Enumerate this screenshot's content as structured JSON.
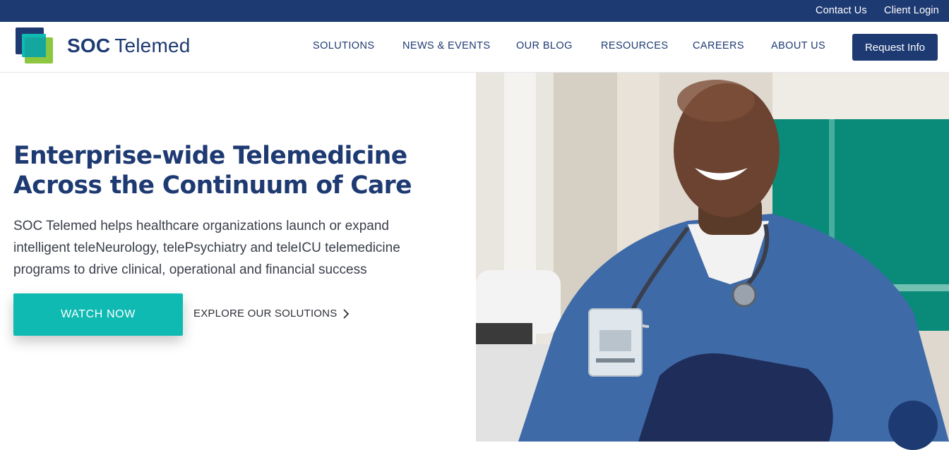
{
  "utility": {
    "contact_label": "Contact Us",
    "login_label": "Client Login"
  },
  "brand": {
    "name_bold": "SOC",
    "name_light": "Telemed",
    "colors": {
      "navy": "#1e3a72",
      "teal": "#0fbab3",
      "green": "#8dc63f"
    }
  },
  "nav": {
    "items": [
      {
        "label": "SOLUTIONS"
      },
      {
        "label": "NEWS & EVENTS"
      },
      {
        "label": "OUR BLOG"
      },
      {
        "label": "RESOURCES"
      },
      {
        "label": "CAREERS"
      },
      {
        "label": "ABOUT US"
      }
    ],
    "cta_label": "Request Info"
  },
  "hero": {
    "title_lines": [
      "Enterprise-wide Telemedicine",
      "Across the Continuum of Care"
    ],
    "description_lines": [
      "SOC Telemed helps healthcare organizations launch or expand",
      "intelligent teleNeurology, telePsychiatry and teleICU telemedicine",
      "programs to drive clinical, operational and financial success"
    ],
    "primary_cta": "WATCH NOW",
    "secondary_cta": "EXPLORE OUR SOLUTIONS",
    "secondary_icon": "chevron-right-icon",
    "image_icon": "doctor-photo"
  },
  "chat": {
    "icon": "chat-bubble-icon"
  }
}
